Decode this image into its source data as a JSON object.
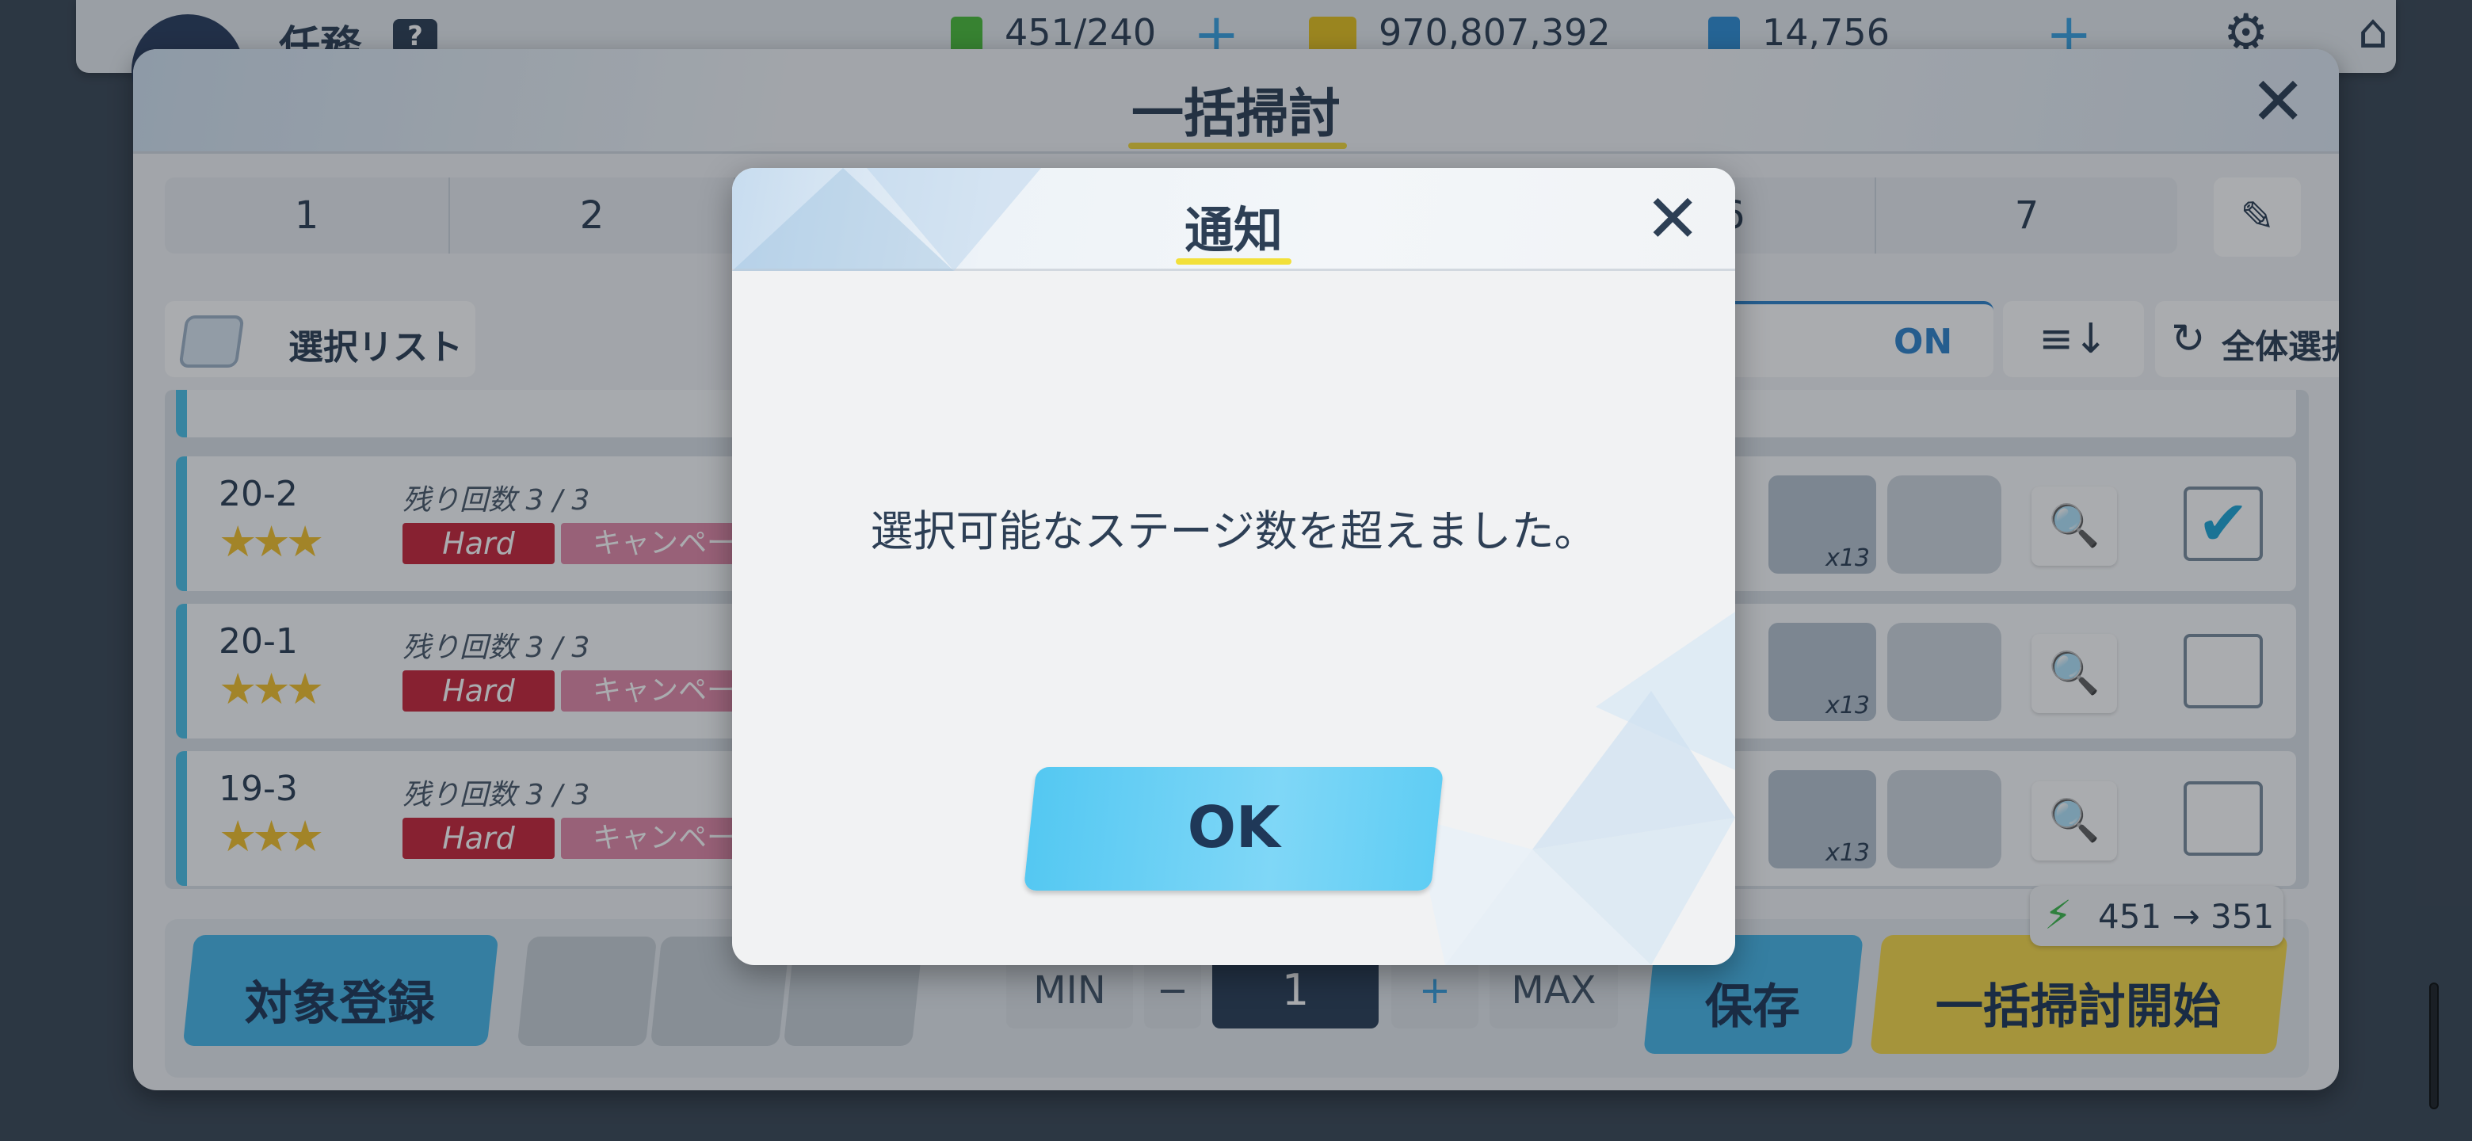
{
  "topbar": {
    "title": "任務",
    "help": "?",
    "ap": "451/240",
    "credits": "970,807,392",
    "gems": "14,756",
    "plus": "+"
  },
  "panel": {
    "title": "一括掃討",
    "close": "✕",
    "tabs": [
      "1",
      "2",
      "",
      "",
      "6",
      "7"
    ],
    "edit_icon": "✎",
    "select_list": "選択リスト",
    "auto_toggle": "ON",
    "sort_icon": "≡↓",
    "deselect_icon": "↻",
    "deselect_all": "全体選択解除"
  },
  "stages": [
    {
      "id": "20-2",
      "stars": "★★★",
      "remain": "残り回数 3 / 3",
      "diff": "Hard",
      "tag": "キャンペーン",
      "reward_count": "x13",
      "checked": "✔"
    },
    {
      "id": "20-1",
      "stars": "★★★",
      "remain": "残り回数 3 / 3",
      "diff": "Hard",
      "tag": "キャンペーン",
      "reward_count": "x13",
      "checked": ""
    },
    {
      "id": "19-3",
      "stars": "★★★",
      "remain": "残り回数 3 / 3",
      "diff": "Hard",
      "tag": "キャンペーン",
      "reward_count": "x13",
      "checked": ""
    }
  ],
  "bottom": {
    "register": "対象登録",
    "min": "MIN",
    "minus": "−",
    "count": "1",
    "plus": "+",
    "max": "MAX",
    "save": "保存",
    "start": "一括掃討開始",
    "ap_change": "451 → 351"
  },
  "dialog": {
    "title": "通知",
    "close": "✕",
    "message": "選択可能なステージ数を超えました。",
    "ok": "OK"
  },
  "icons": {
    "zoom": "🔍",
    "gear": "⚙",
    "home": "⌂",
    "bolt": "⚡"
  },
  "colors": {
    "accent_blue": "#49b8ea",
    "accent_yellow": "#f7d94a",
    "hard_red": "#c8273a",
    "campaign_pink": "#e38aa9",
    "text_navy": "#2d3f55"
  }
}
